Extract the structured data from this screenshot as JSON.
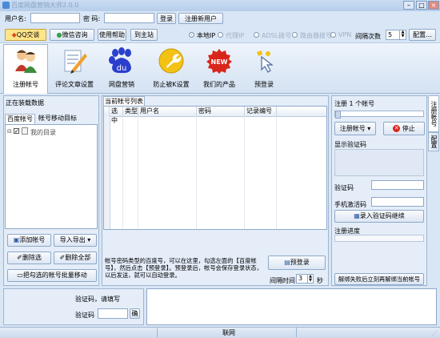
{
  "window": {
    "title": "百度网盘营销大师2.0.0"
  },
  "login": {
    "username_label": "用户名:",
    "password_label": "密  码:",
    "login_button": "登录",
    "register_button": "注册新用户"
  },
  "toolbar2": {
    "qq_button": "QQ交谈",
    "wechat_button": "微信咨询",
    "help_button": "使用帮助",
    "home_button": "到主站",
    "ip_options": [
      "本地IP",
      "代理IP",
      "ADSL拨号",
      "路由器拨号",
      "VPN"
    ],
    "interval_label": "间隔次数",
    "interval_value": "5",
    "config_button": "配置..."
  },
  "tools": [
    {
      "icon": "users-icon",
      "label": "注册帐号"
    },
    {
      "icon": "note-edit-icon",
      "label": "评论文章设置"
    },
    {
      "icon": "baidu-pan-icon",
      "label": "网盘营销"
    },
    {
      "icon": "wrench-icon",
      "label": "防止被K设置"
    },
    {
      "icon": "new-badge-icon",
      "label": "我们的产品"
    },
    {
      "icon": "pointer-icon",
      "label": "预登录"
    }
  ],
  "left_panel": {
    "status": "正在装载数据",
    "tabs": [
      "百度帐号",
      "帐号移动目标"
    ],
    "tree_root": "我的目录",
    "buttons": {
      "add": "添加帐号",
      "import_export": "导入导出",
      "delete_selected": "删除选",
      "delete_all": "删除全部",
      "batch_move": "把勾选的帐号批量移动"
    }
  },
  "center": {
    "tab": "当前帐号列表",
    "columns": [
      "选中",
      "类型",
      "用户名",
      "密码",
      "记录编号"
    ],
    "description": "帐号密码类型的百度号，可以在这里，勾选左面的【百度帐号】，然后点击【预登录】。预登录后，帐号会保存登录状态，以后发送，就可以自动登录。",
    "prelogin_button": "预登录",
    "interval_label": "间隔时间",
    "interval_value": "3",
    "interval_unit": "秒"
  },
  "right_panel": {
    "register_count": "注册 1 个帐号",
    "register_button": "注册帐号",
    "stop_button": "停止",
    "show_captcha": "显示验证码",
    "captcha_label": "验证码",
    "sms_label": "手机激活码",
    "submit_button": "录入验证码继续",
    "progress_label": "注册进度",
    "reregister_button": "解绑失败后立刻再解绑当前帐号"
  },
  "side_tabs": [
    "注册帐号",
    "配置"
  ],
  "bottom": {
    "captcha_prompt": "验证码，请填写",
    "captcha_label": "验证码",
    "confirm_button": "确"
  },
  "statusbar": {
    "network": "联网"
  },
  "colors": {
    "accent": "#4c8ad6",
    "window_bg": "#d9e6f5",
    "stop_red": "#d9261c"
  }
}
